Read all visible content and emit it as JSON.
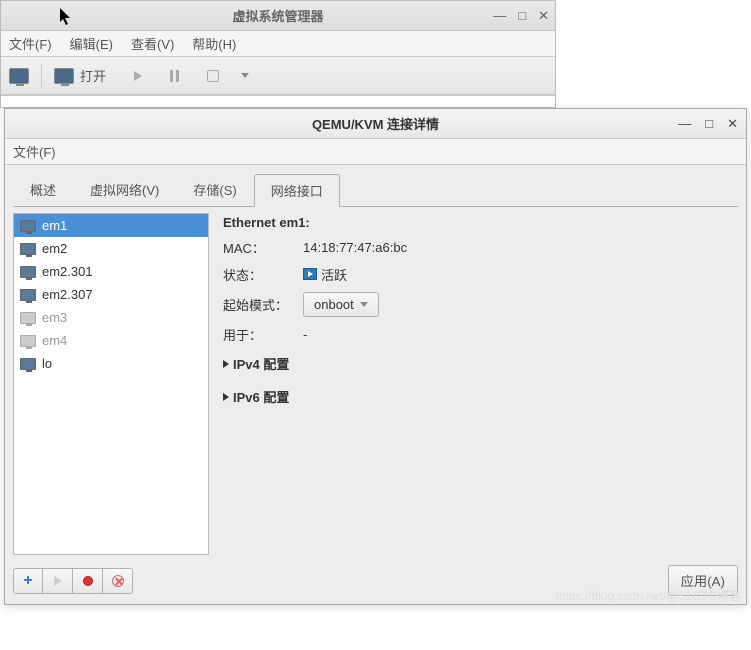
{
  "back_window": {
    "title": "虚拟系统管理器",
    "menu": {
      "file": "文件(F)",
      "edit": "编辑(E)",
      "view": "查看(V)",
      "help": "帮助(H)"
    },
    "toolbar": {
      "open": "打开"
    }
  },
  "front_window": {
    "title": "QEMU/KVM 连接详情",
    "menu": {
      "file": "文件(F)"
    },
    "tabs": {
      "overview": "概述",
      "vnet": "虚拟网络(V)",
      "storage": "存储(S)",
      "netif": "网络接口"
    },
    "interfaces": [
      {
        "name": "em1",
        "active": true,
        "selected": true
      },
      {
        "name": "em2",
        "active": true
      },
      {
        "name": "em2.301",
        "active": true
      },
      {
        "name": "em2.307",
        "active": true
      },
      {
        "name": "em3",
        "active": false
      },
      {
        "name": "em4",
        "active": false
      },
      {
        "name": "lo",
        "active": true
      }
    ],
    "details": {
      "title": "Ethernet em1:",
      "mac_label": "MAC：",
      "mac_value": "14:18:77:47:a6:bc",
      "status_label": "状态：",
      "status_value": "活跃",
      "startmode_label": "起始模式：",
      "startmode_value": "onboot",
      "usedby_label": "用于：",
      "usedby_value": "-",
      "ipv4": "IPv4 配置",
      "ipv6": "IPv6 配置"
    },
    "buttons": {
      "apply": "应用(A)"
    }
  },
  "watermark": "https://blog.csdn.net/@51CTO博客"
}
